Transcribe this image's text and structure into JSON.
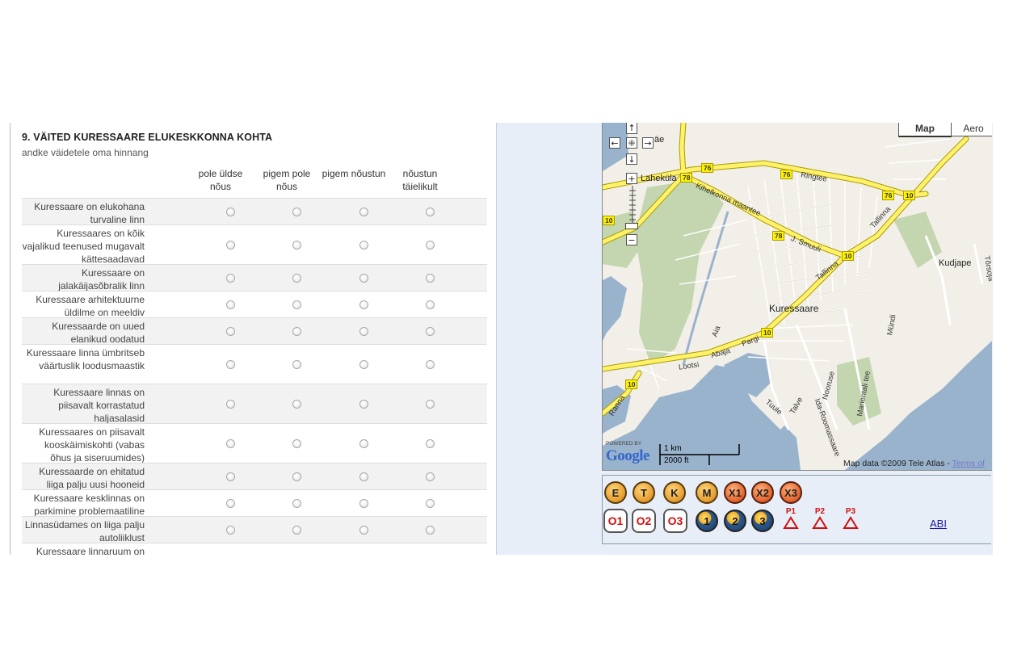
{
  "question": {
    "title": "9. VÄITED KURESSAARE ELUKESKKONNA KOHTA",
    "subtitle": "andke väidetele oma hinnang"
  },
  "scale": [
    "pole üldse nõus",
    "pigem pole nõus",
    "pigem nõustun",
    "nõustun täielikult"
  ],
  "statements": [
    "Kuressaare on elukohana turvaline linn",
    "Kuressaares on kõik vajalikud teenused mugavalt kättesaadavad",
    "Kuressaare on jalakäijasõbralik linn",
    "Kuressaare arhitektuurne üldilme on meeldiv",
    "Kuressaarde on uued elanikud oodatud",
    "Kuressaare linna ümbritseb väärtuslik loodusmaastik",
    "Kuressaare linnas on piisavalt korrastatud haljasalasid",
    "Kuressaares on piisavalt kooskäimiskohti (vabas õhus ja siseruumides)",
    "Kuressaarde on ehitatud liiga palju uusi hooneid",
    "Kuressaare kesklinnas on parkimine problemaatiline",
    "Linnasüdames on liiga palju autoliiklust",
    "Kuressaare linnaruum on"
  ],
  "map": {
    "map_types": [
      "Map",
      "Aero"
    ],
    "active_map_type": "Map",
    "places": [
      "Laheküla",
      "Kuressaare",
      "Kudjape"
    ],
    "partial_place": "äe",
    "streets": [
      "Kihelkonna maantee",
      "Ringtee",
      "J. Smuuli",
      "Tallinna",
      "Tallinna",
      "Lootsi",
      "Abaja",
      "Pargi",
      "Aia",
      "Ranna",
      "Tuule",
      "Talve",
      "Nooruse",
      "Ida-Roomassaare",
      "Marientali tee",
      "Mündi",
      "Tõrsoja"
    ],
    "route_shields": [
      "76",
      "76",
      "76",
      "78",
      "78",
      "10",
      "10",
      "10",
      "10",
      "10"
    ],
    "powered_by": "POWERED BY",
    "logo_text": "Google",
    "scale_km": "1 km",
    "scale_ft": "2000 ft",
    "attribution": "Map data ©2009 Tele Atlas - ",
    "terms_link": "Terms of",
    "controls": {
      "up": "↑",
      "down": "↓",
      "left": "←",
      "right": "→",
      "center": "⁜",
      "zoom_in": "+",
      "zoom_out": "−"
    }
  },
  "toolbar": {
    "row1": [
      "E",
      "T",
      "K",
      "M",
      "X1",
      "X2",
      "X3"
    ],
    "row2_circles": [
      "O1",
      "O2",
      "O3"
    ],
    "row2_blue": [
      "1",
      "2",
      "3"
    ],
    "row2_triangles": [
      "P1",
      "P2",
      "P3"
    ],
    "help_link": "ABI"
  }
}
